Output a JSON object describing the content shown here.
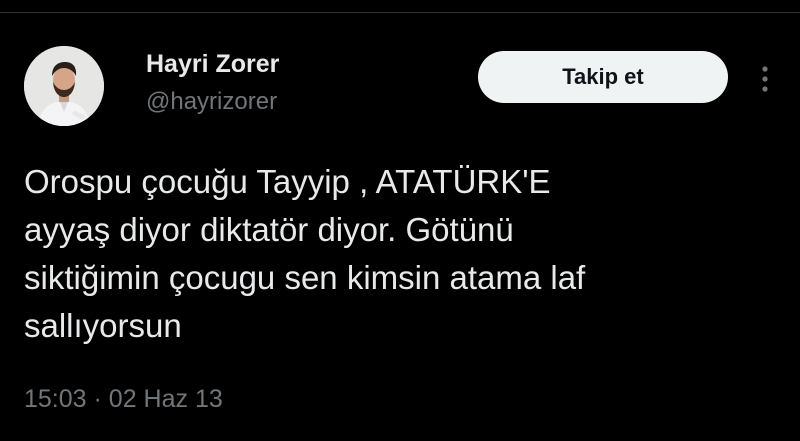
{
  "author": {
    "display_name": "Hayri Zorer",
    "handle": "@hayrizorer",
    "avatar_icon": "profile-photo"
  },
  "actions": {
    "follow_label": "Takip et",
    "more_icon": "more-vertical-icon"
  },
  "tweet": {
    "lines": [
      "Orospu çocuğu Tayyip , ATATÜRK'E",
      "ayyaş diyor diktatör diyor. Götünü",
      "siktiğimin çocugu sen kimsin atama laf",
      "sallıyorsun"
    ],
    "time": "15:03",
    "separator": "·",
    "date": "02 Haz 13"
  },
  "colors": {
    "background": "#000000",
    "primary_text": "#e7e9ea",
    "secondary_text": "#71767b",
    "button_bg": "#eff3f4",
    "button_text": "#0f1419"
  }
}
